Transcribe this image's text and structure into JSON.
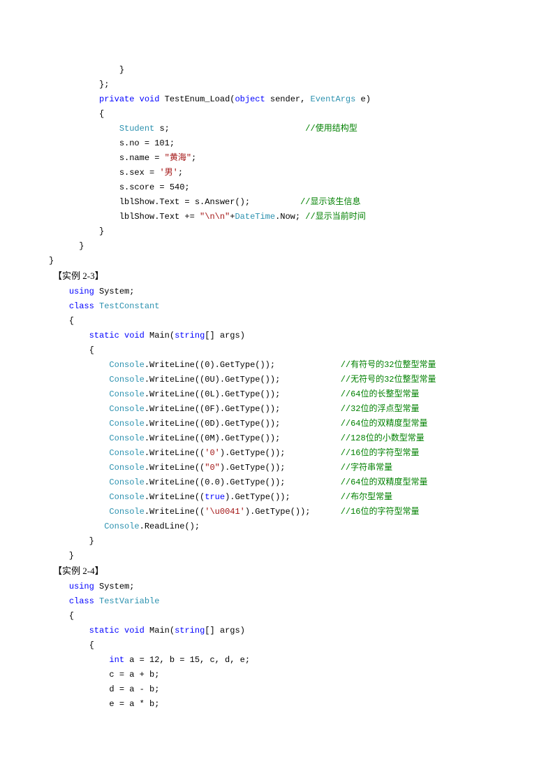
{
  "code1": {
    "l1": "              }",
    "l2": "          };",
    "l3a": "          ",
    "l3_kw1": "private",
    "l3_sp1": " ",
    "l3_kw2": "void",
    "l3_sp2": " TestEnum_Load(",
    "l3_kw3": "object",
    "l3_sp3": " sender, ",
    "l3_type": "EventArgs",
    "l3_sp4": " e)",
    "l4": "          {",
    "l5a": "              ",
    "l5_type": "Student",
    "l5b": " s;                           ",
    "l5_cmt": "//使用结构型",
    "l6": "              s.no = 101;",
    "l7a": "              s.name = ",
    "l7_str": "\"黄海\"",
    "l7b": ";",
    "l8a": "              s.sex = ",
    "l8_str": "'男'",
    "l8b": ";",
    "l9": "              s.score = 540;",
    "l10a": "              lblShow.Text = s.Answer();          ",
    "l10_cmt": "//显示该生信息",
    "l11a": "              lblShow.Text += ",
    "l11_str": "\"\\n\\n\"",
    "l11b": "+",
    "l11_type": "DateTime",
    "l11c": ".Now; ",
    "l11_cmt": "//显示当前时间",
    "l12": "          }",
    "l13": "      }",
    "l14": "}"
  },
  "heading1": "【实例 2-3】",
  "code2": {
    "l1a": "    ",
    "l1_kw": "using",
    "l1b": " System;",
    "l2a": "    ",
    "l2_kw": "class",
    "l2b": " ",
    "l2_type": "TestConstant",
    "l3": "    {",
    "l4a": "        ",
    "l4_kw1": "static",
    "l4_sp": " ",
    "l4_kw2": "void",
    "l4b": " Main(",
    "l4_kw3": "string",
    "l4c": "[] args)",
    "l5": "        {",
    "l6a": "            ",
    "l6_type": "Console",
    "l6b": ".WriteLine((0).GetType());             ",
    "l6_cmt": "//有符号的32位整型常量",
    "l7a": "            ",
    "l7_type": "Console",
    "l7b": ".WriteLine((0U).GetType());            ",
    "l7_cmt": "//无符号的32位整型常量",
    "l8a": "            ",
    "l8_type": "Console",
    "l8b": ".WriteLine((0L).GetType());            ",
    "l8_cmt": "//64位的长整型常量",
    "l9a": "            ",
    "l9_type": "Console",
    "l9b": ".WriteLine((0F).GetType());            ",
    "l9_cmt": "//32位的浮点型常量",
    "l10a": "            ",
    "l10_type": "Console",
    "l10b": ".WriteLine((0D).GetType());            ",
    "l10_cmt": "//64位的双精度型常量",
    "l11a": "            ",
    "l11_type": "Console",
    "l11b": ".WriteLine((0M).GetType());            ",
    "l11_cmt": "//128位的小数型常量",
    "l12a": "            ",
    "l12_type": "Console",
    "l12b": ".WriteLine((",
    "l12_str": "'0'",
    "l12c": ").GetType());           ",
    "l12_cmt": "//16位的字符型常量",
    "l13a": "            ",
    "l13_type": "Console",
    "l13b": ".WriteLine((",
    "l13_str": "\"0\"",
    "l13c": ").GetType());           ",
    "l13_cmt": "//字符串常量",
    "l14a": "            ",
    "l14_type": "Console",
    "l14b": ".WriteLine((0.0).GetType());           ",
    "l14_cmt": "//64位的双精度型常量",
    "l15a": "            ",
    "l15_type": "Console",
    "l15b": ".WriteLine((",
    "l15_kw": "true",
    "l15c": ").GetType());          ",
    "l15_cmt": "//布尔型常量",
    "l16a": "            ",
    "l16_type": "Console",
    "l16b": ".WriteLine((",
    "l16_str": "'\\u0041'",
    "l16c": ").GetType());      ",
    "l16_cmt": "//16位的字符型常量",
    "l17a": "           ",
    "l17_type": "Console",
    "l17b": ".ReadLine();",
    "l18": "        }",
    "l19": "    }"
  },
  "heading2": "【实例 2-4】",
  "code3": {
    "l1a": "    ",
    "l1_kw": "using",
    "l1b": " System;",
    "l2a": "    ",
    "l2_kw": "class",
    "l2b": " ",
    "l2_type": "TestVariable",
    "l3": "    {",
    "l4a": "        ",
    "l4_kw1": "static",
    "l4_sp": " ",
    "l4_kw2": "void",
    "l4b": " Main(",
    "l4_kw3": "string",
    "l4c": "[] args)",
    "l5": "        {",
    "l6a": "            ",
    "l6_kw": "int",
    "l6b": " a = 12, b = 15, c, d, e;",
    "l7": "            c = a + b;",
    "l8": "            d = a - b;",
    "l9": "            e = a * b;"
  }
}
